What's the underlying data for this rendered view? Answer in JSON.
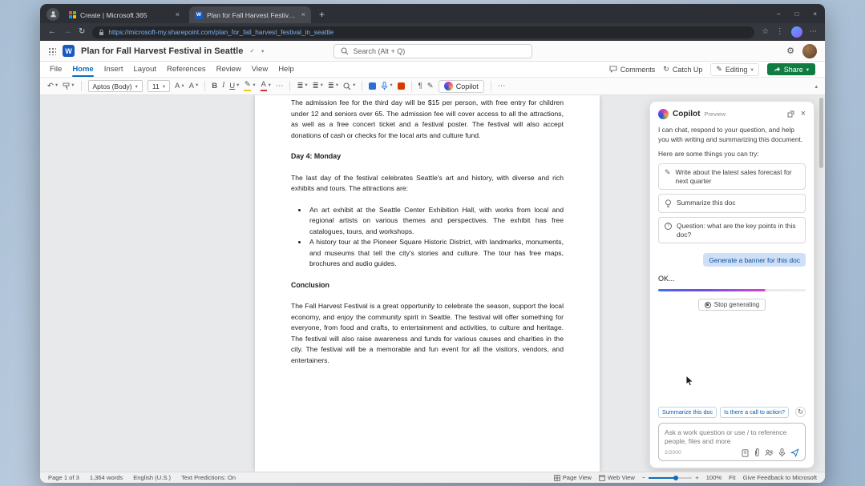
{
  "logos": {
    "word": "W"
  },
  "icons": {
    "back": "←",
    "forward": "→",
    "refresh": "↻",
    "star": "☆",
    "more": "⋯",
    "menu_dots": "⋮",
    "close": "×",
    "new_tab": "+",
    "minimize": "–",
    "maximize": "□",
    "chevron_down": "▾",
    "caret_up": "▴",
    "undo": "↶",
    "check": "✓",
    "paragraph": "¶",
    "pencil": "✎",
    "list": "≣",
    "minus": "−",
    "plus": "+",
    "gear": "⚙",
    "question": "?"
  },
  "browser": {
    "tabs": [
      {
        "label": "Create | Microsoft 365"
      },
      {
        "label": "Plan for Fall Harvest Festival in Se..."
      }
    ],
    "url": "https://microsoft-my.sharepoint.com/plan_for_fall_harvest_festival_in_seattle"
  },
  "header": {
    "title": "Plan for Fall Harvest Festival in Seattle",
    "search_placeholder": "Search (Alt + Q)"
  },
  "menu": {
    "items": [
      "File",
      "Home",
      "Insert",
      "Layout",
      "References",
      "Review",
      "View",
      "Help"
    ],
    "comments": "Comments",
    "catch_up": "Catch Up",
    "editing": "Editing",
    "share": "Share"
  },
  "toolbar": {
    "font": "Aptos (Body)",
    "font_size": "11",
    "bold": "B",
    "italic": "I",
    "underline": "U",
    "grow_font": "A",
    "shrink_font": "A",
    "font_color": "A",
    "copilot": "Copilot"
  },
  "document": {
    "paragraph_top": "The admission fee for the third day will be $15 per person, with free entry for children under 12 and seniors over 65. The admission fee will cover access to all the attractions, as well as a free concert ticket and a festival poster. The festival will also accept donations of cash or checks for the local arts and culture fund.",
    "day4_heading": "Day 4: Monday",
    "day4_intro": "The last day of the festival celebrates Seattle's art and history, with diverse and rich exhibits and tours. The attractions are:",
    "bullets": [
      "An art exhibit at the Seattle Center Exhibition Hall, with works from local and regional artists on various themes and perspectives. The exhibit has free catalogues, tours, and workshops.",
      "A history tour at the Pioneer Square Historic District, with landmarks, monuments, and museums that tell the city's stories and culture. The tour has free maps, brochures and audio guides."
    ],
    "conclusion_heading": "Conclusion",
    "conclusion": "The Fall Harvest Festival is a great opportunity to celebrate the season, support the local economy, and enjoy the community spirit in Seattle. The festival will offer something for everyone, from food and crafts, to entertainment and activities, to culture and heritage. The festival will also raise awareness and funds for various causes and charities in the city. The festival will be a memorable and fun event for all the visitors, vendors, and entertainers."
  },
  "copilot": {
    "title": "Copilot",
    "badge": "Preview",
    "intro": "I can chat, respond to your question, and help you with writing and summarizing this document.",
    "try_label": "Here are some things you can try:",
    "suggestions": [
      {
        "label": "Write about the latest sales forecast for next quarter"
      },
      {
        "label": "Summarize this doc"
      },
      {
        "label": "Question: what are the key points in this doc?"
      }
    ],
    "user_chip": "Generate a banner for this doc",
    "response_text": "OK...",
    "stop_label": "Stop generating",
    "footer_chips": [
      "Summarize this doc",
      "Is there a call to action?"
    ],
    "input_placeholder": "Ask a work question or use / to reference people, files and more",
    "char_count": "2/2000"
  },
  "status": {
    "page": "Page 1 of 3",
    "words": "1,364 words",
    "language": "English (U.S.)",
    "predictions": "Text Predictions: On",
    "page_view": "Page View",
    "web_view": "Web View",
    "zoom": "100%",
    "fit": "Fit",
    "feedback": "Give Feedback to Microsoft"
  }
}
